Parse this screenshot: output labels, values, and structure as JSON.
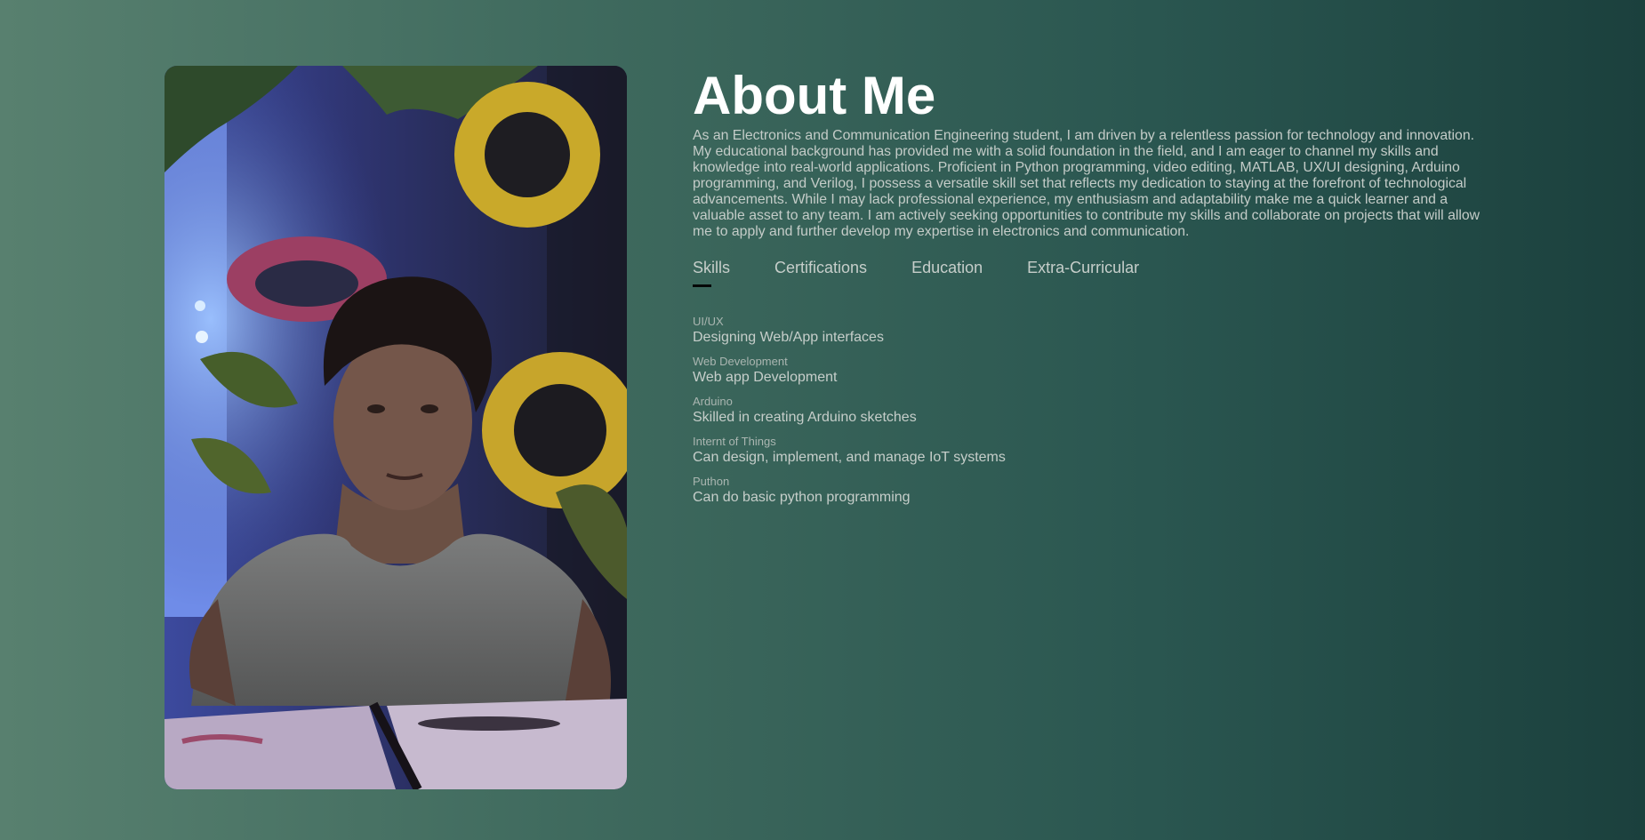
{
  "about": {
    "title": "About Me",
    "description": "As an Electronics and Communication Engineering student, I am driven by a relentless passion for technology and innovation. My educational background has provided me with a solid foundation in the field, and I am eager to channel my skills and knowledge into real-world applications. Proficient in Python programming, video editing, MATLAB, UX/UI designing, Arduino programming, and Verilog, I possess a versatile skill set that reflects my dedication to staying at the forefront of technological advancements. While I may lack professional experience, my enthusiasm and adaptability make me a quick learner and a valuable asset to any team. I am actively seeking opportunities to contribute my skills and collaborate on projects that will allow me to apply and further develop my expertise in electronics and communication."
  },
  "tabs": [
    {
      "label": "Skills",
      "active": true
    },
    {
      "label": "Certifications",
      "active": false
    },
    {
      "label": "Education",
      "active": false
    },
    {
      "label": "Extra-Curricular",
      "active": false
    }
  ],
  "skills": [
    {
      "name": "UI/UX",
      "desc": "Designing Web/App interfaces"
    },
    {
      "name": "Web Development",
      "desc": "Web app Development"
    },
    {
      "name": "Arduino",
      "desc": "Skilled in creating Arduino sketches"
    },
    {
      "name": "Internt of Things",
      "desc": "Can design, implement, and manage IoT systems"
    },
    {
      "name": "Puthon",
      "desc": "Can do basic python programming"
    }
  ],
  "colors": {
    "background_left": "#58806f",
    "background_right": "#1b403d",
    "title": "#ffffff",
    "body_text": "#c4ccc8",
    "tab_underline": "#050808"
  },
  "icons": {
    "profile_photo": "portrait-photo"
  }
}
